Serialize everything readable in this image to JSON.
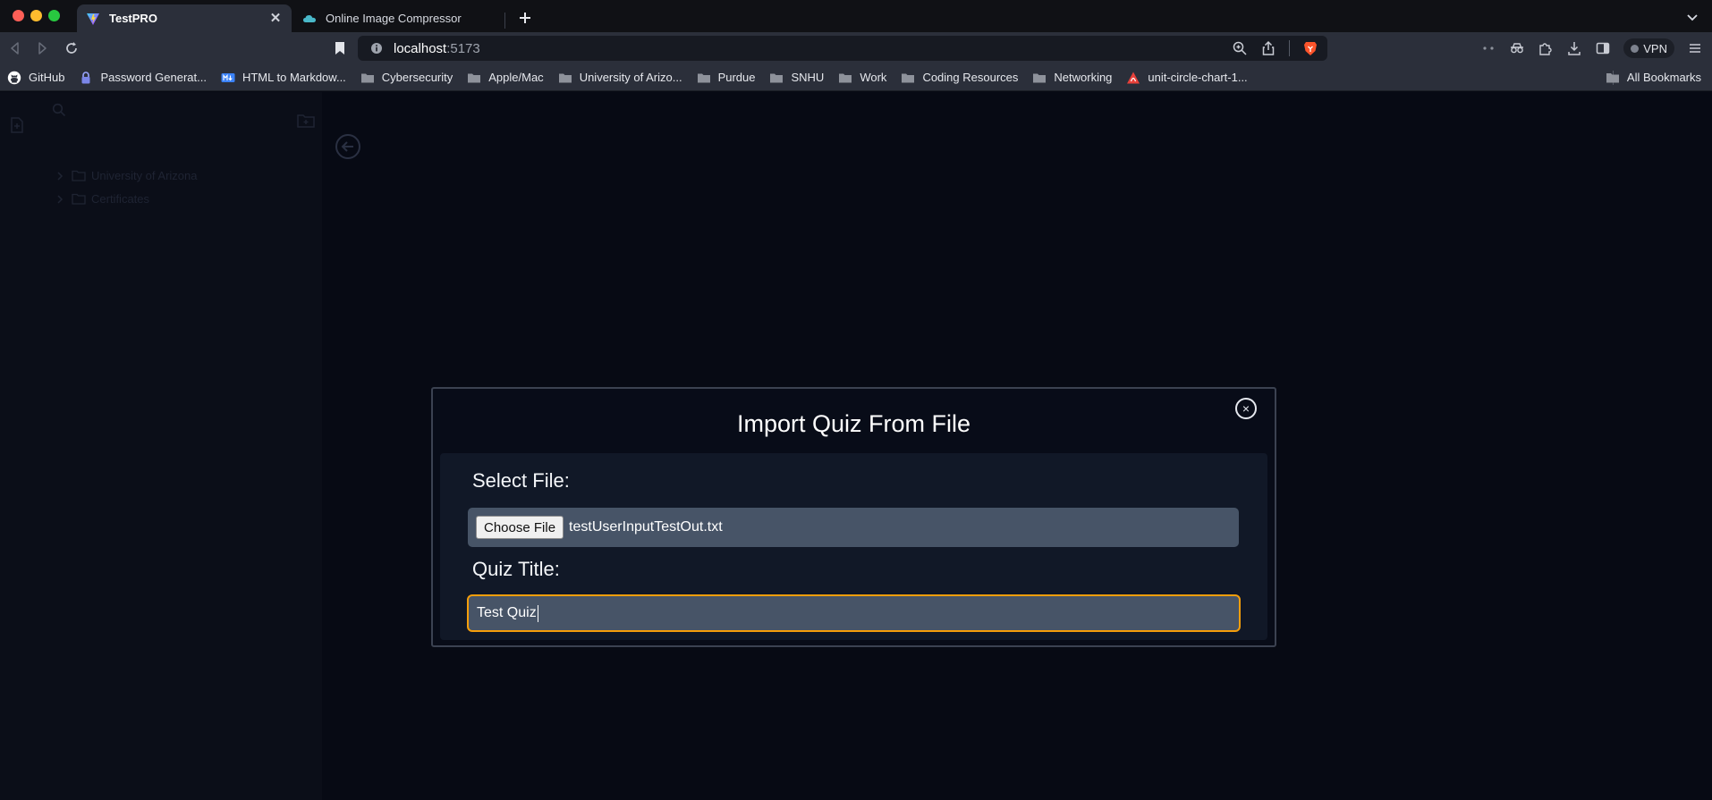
{
  "tabs": [
    {
      "title": "TestPRO",
      "active": true,
      "favicon": "vite-logo-icon"
    },
    {
      "title": "Online Image Compressor",
      "active": false,
      "favicon": "cloud-icon"
    }
  ],
  "address_bar": {
    "host": "localhost",
    "port": ":5173"
  },
  "vpn_label": "VPN",
  "bookmarks": [
    {
      "label": "GitHub",
      "icon": "github-icon"
    },
    {
      "label": "Password Generat...",
      "icon": "lock-icon"
    },
    {
      "label": "HTML to Markdow...",
      "icon": "markdown-icon"
    },
    {
      "label": "Cybersecurity",
      "icon": "folder-icon"
    },
    {
      "label": "Apple/Mac",
      "icon": "folder-icon"
    },
    {
      "label": "University of Arizo...",
      "icon": "folder-icon"
    },
    {
      "label": "Purdue",
      "icon": "folder-icon"
    },
    {
      "label": "SNHU",
      "icon": "folder-icon"
    },
    {
      "label": "Work",
      "icon": "folder-icon"
    },
    {
      "label": "Coding Resources",
      "icon": "folder-icon"
    },
    {
      "label": "Networking",
      "icon": "folder-icon"
    },
    {
      "label": "unit-circle-chart-1...",
      "icon": "pdf-icon"
    }
  ],
  "all_bookmarks_label": "All Bookmarks",
  "background_sidebar": {
    "folders": [
      "University of Arizona",
      "Certificates"
    ]
  },
  "modal": {
    "title": "Import Quiz From File",
    "select_file_label": "Select File:",
    "choose_file_button": "Choose File",
    "selected_file": "testUserInputTestOut.txt",
    "quiz_title_label": "Quiz Title:",
    "quiz_title_value": "Test Quiz",
    "close_symbol": "×"
  },
  "colors": {
    "page_background": "#070a14",
    "modal_body": "#111827",
    "input_background": "#475467",
    "focus_ring": "#f59e0b"
  }
}
